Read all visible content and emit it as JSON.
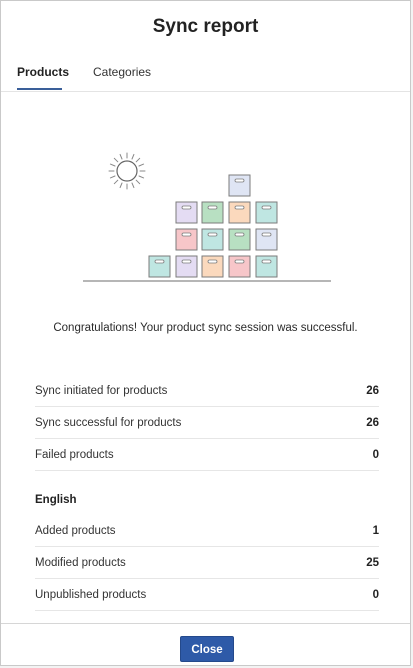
{
  "dialog": {
    "title": "Sync report"
  },
  "tabs": [
    {
      "label": "Products",
      "active": true
    },
    {
      "label": "Categories",
      "active": false
    }
  ],
  "illustration": {
    "icons": [
      "sun-icon",
      "stacked-boxes-icon"
    ]
  },
  "message": "Congratulations! Your product sync session was successful.",
  "summary": [
    {
      "label": "Sync initiated for products",
      "value": "26"
    },
    {
      "label": "Sync successful for products",
      "value": "26"
    },
    {
      "label": "Failed products",
      "value": "0"
    }
  ],
  "language_section": {
    "heading": "English",
    "rows": [
      {
        "label": "Added products",
        "value": "1"
      },
      {
        "label": "Modified products",
        "value": "25"
      },
      {
        "label": "Unpublished products",
        "value": "0"
      }
    ]
  },
  "footer": {
    "close_label": "Close"
  },
  "colors": {
    "accent": "#2e5aa8",
    "tab_underline": "#3a5f99",
    "box_purple": "#e4dcf3",
    "box_green": "#b8e0c2",
    "box_peach": "#fbd9bd",
    "box_teal": "#bfe6e2",
    "box_blue": "#dfe5f4",
    "box_pink": "#f7c6c9"
  }
}
